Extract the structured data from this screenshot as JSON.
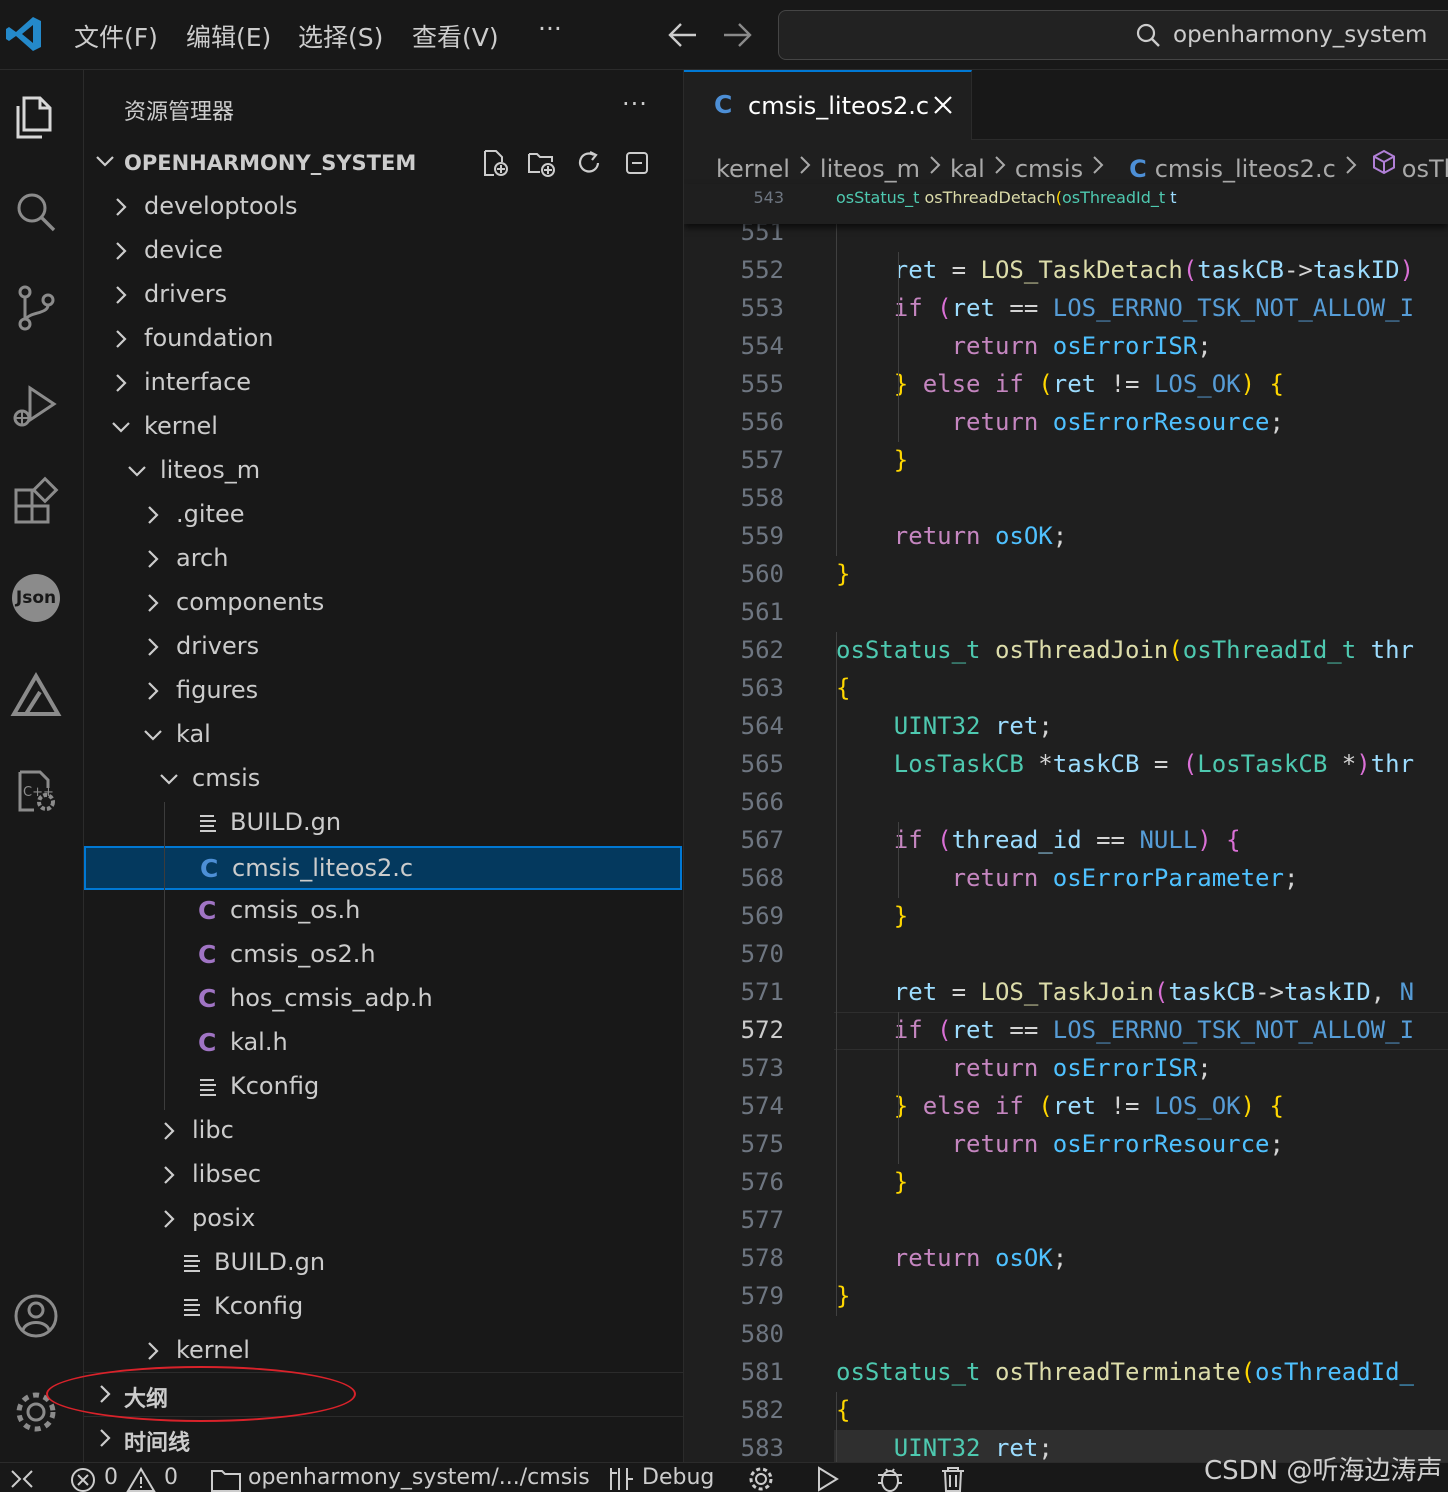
{
  "menu": [
    "文件(F)",
    "编辑(E)",
    "选择(S)",
    "查看(V)",
    "···"
  ],
  "command_center": {
    "text": "openharmony_system"
  },
  "activity_icons": [
    "explorer-icon",
    "search-icon",
    "source-control-icon",
    "run-debug-icon",
    "extensions-icon",
    "json-icon",
    "deveco-icon",
    "cpp-settings-icon",
    "account-icon",
    "settings-gear-icon"
  ],
  "json_badge": "Json",
  "sidebar": {
    "title": "资源管理器",
    "more": "···",
    "workspace": "OPENHARMONY_SYSTEM",
    "tree": [
      {
        "label": "developtools",
        "depth": 0,
        "kind": "folder",
        "open": false
      },
      {
        "label": "device",
        "depth": 0,
        "kind": "folder",
        "open": false
      },
      {
        "label": "drivers",
        "depth": 0,
        "kind": "folder",
        "open": false
      },
      {
        "label": "foundation",
        "depth": 0,
        "kind": "folder",
        "open": false
      },
      {
        "label": "interface",
        "depth": 0,
        "kind": "folder",
        "open": false
      },
      {
        "label": "kernel",
        "depth": 0,
        "kind": "folder",
        "open": true
      },
      {
        "label": "liteos_m",
        "depth": 1,
        "kind": "folder",
        "open": true
      },
      {
        "label": ".gitee",
        "depth": 2,
        "kind": "folder",
        "open": false
      },
      {
        "label": "arch",
        "depth": 2,
        "kind": "folder",
        "open": false
      },
      {
        "label": "components",
        "depth": 2,
        "kind": "folder",
        "open": false
      },
      {
        "label": "drivers",
        "depth": 2,
        "kind": "folder",
        "open": false
      },
      {
        "label": "figures",
        "depth": 2,
        "kind": "folder",
        "open": false
      },
      {
        "label": "kal",
        "depth": 2,
        "kind": "folder",
        "open": true
      },
      {
        "label": "cmsis",
        "depth": 3,
        "kind": "folder",
        "open": true
      },
      {
        "label": "BUILD.gn",
        "depth": 4,
        "kind": "text"
      },
      {
        "label": "cmsis_liteos2.c",
        "depth": 4,
        "kind": "c",
        "selected": true
      },
      {
        "label": "cmsis_os.h",
        "depth": 4,
        "kind": "h"
      },
      {
        "label": "cmsis_os2.h",
        "depth": 4,
        "kind": "h"
      },
      {
        "label": "hos_cmsis_adp.h",
        "depth": 4,
        "kind": "h"
      },
      {
        "label": "kal.h",
        "depth": 4,
        "kind": "h"
      },
      {
        "label": "Kconfig",
        "depth": 4,
        "kind": "text"
      },
      {
        "label": "libc",
        "depth": 3,
        "kind": "folder",
        "open": false
      },
      {
        "label": "libsec",
        "depth": 3,
        "kind": "folder",
        "open": false
      },
      {
        "label": "posix",
        "depth": 3,
        "kind": "folder",
        "open": false
      },
      {
        "label": "BUILD.gn",
        "depth": 3,
        "kind": "text"
      },
      {
        "label": "Kconfig",
        "depth": 3,
        "kind": "text"
      },
      {
        "label": "kernel",
        "depth": 2,
        "kind": "folder",
        "open": false
      }
    ],
    "outline_label": "大纲",
    "timeline_label": "时间线",
    "c_glyph": "C"
  },
  "editor": {
    "tab_label": "cmsis_liteos2.c",
    "breadcrumb": [
      "kernel",
      "liteos_m",
      "kal",
      "cmsis",
      "cmsis_liteos2.c",
      "osThr"
    ],
    "sticky": {
      "ln": "543",
      "text": "osStatus_t osThreadDetach(osThreadId_t t"
    },
    "current_line": "572",
    "lines": [
      {
        "ln": "551",
        "text": ""
      },
      {
        "ln": "552",
        "text": "    ret = LOS_TaskDetach(taskCB->taskID)"
      },
      {
        "ln": "553",
        "text": "    if (ret == LOS_ERRNO_TSK_NOT_ALLOW_I"
      },
      {
        "ln": "554",
        "text": "        return osErrorISR;"
      },
      {
        "ln": "555",
        "text": "    } else if (ret != LOS_OK) {"
      },
      {
        "ln": "556",
        "text": "        return osErrorResource;"
      },
      {
        "ln": "557",
        "text": "    }"
      },
      {
        "ln": "558",
        "text": ""
      },
      {
        "ln": "559",
        "text": "    return osOK;"
      },
      {
        "ln": "560",
        "text": "}"
      },
      {
        "ln": "561",
        "text": ""
      },
      {
        "ln": "562",
        "text": "osStatus_t osThreadJoin(osThreadId_t thr"
      },
      {
        "ln": "563",
        "text": "{"
      },
      {
        "ln": "564",
        "text": "    UINT32 ret;"
      },
      {
        "ln": "565",
        "text": "    LosTaskCB *taskCB = (LosTaskCB *)thr"
      },
      {
        "ln": "566",
        "text": ""
      },
      {
        "ln": "567",
        "text": "    if (thread_id == NULL) {"
      },
      {
        "ln": "568",
        "text": "        return osErrorParameter;"
      },
      {
        "ln": "569",
        "text": "    }"
      },
      {
        "ln": "570",
        "text": ""
      },
      {
        "ln": "571",
        "text": "    ret = LOS_TaskJoin(taskCB->taskID, N"
      },
      {
        "ln": "572",
        "text": "    if (ret == LOS_ERRNO_TSK_NOT_ALLOW_I"
      },
      {
        "ln": "573",
        "text": "        return osErrorISR;"
      },
      {
        "ln": "574",
        "text": "    } else if (ret != LOS_OK) {"
      },
      {
        "ln": "575",
        "text": "        return osErrorResource;"
      },
      {
        "ln": "576",
        "text": "    }"
      },
      {
        "ln": "577",
        "text": ""
      },
      {
        "ln": "578",
        "text": "    return osOK;"
      },
      {
        "ln": "579",
        "text": "}"
      },
      {
        "ln": "580",
        "text": ""
      },
      {
        "ln": "581",
        "text": "osStatus_t osThreadTerminate(osThreadId_"
      },
      {
        "ln": "582",
        "text": "{"
      },
      {
        "ln": "583",
        "text": "    UINT32 ret;"
      }
    ]
  },
  "statusbar": {
    "errors": "0",
    "warnings": "0",
    "path": "openharmony_system/.../cmsis",
    "debug": "Debug"
  },
  "watermark": "CSDN @听海边涛声"
}
